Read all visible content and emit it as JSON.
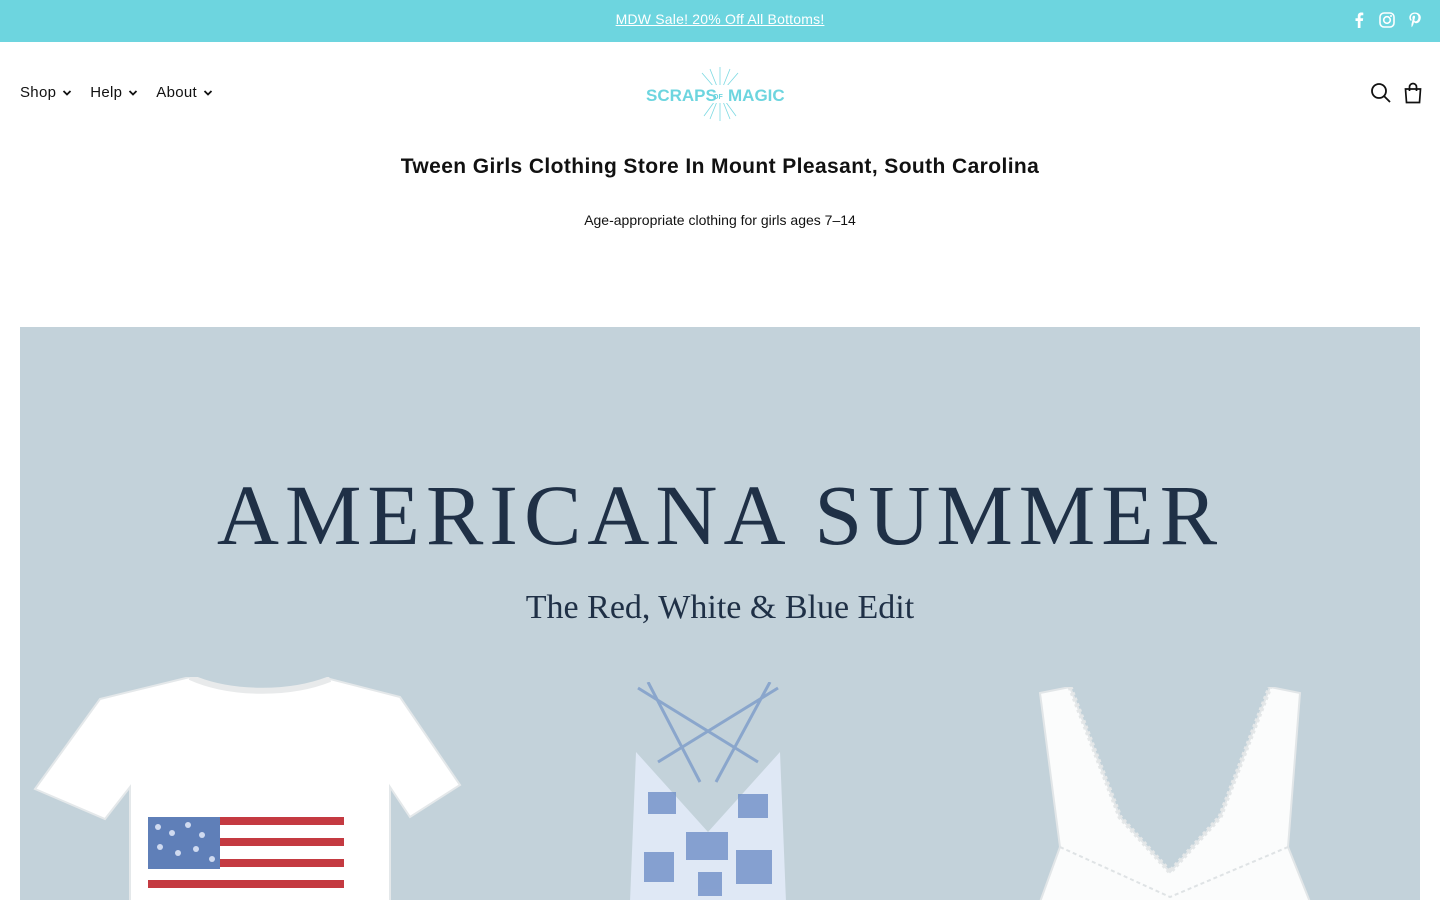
{
  "announcement": {
    "text": "MDW Sale! 20% Off All Bottoms!"
  },
  "social": [
    {
      "icon": "facebook-icon"
    },
    {
      "icon": "instagram-icon"
    },
    {
      "icon": "pinterest-icon"
    }
  ],
  "nav": {
    "items": [
      {
        "label": "Shop"
      },
      {
        "label": "Help"
      },
      {
        "label": "About"
      }
    ]
  },
  "logo": {
    "line1": "SCRAPS",
    "small": "OF",
    "line2": "MAGIC"
  },
  "header_actions": [
    {
      "icon": "search-icon"
    },
    {
      "icon": "cart-icon"
    }
  ],
  "page": {
    "title": "Tween Girls Clothing Store In Mount Pleasant, South Carolina",
    "subtitle": "Age-appropriate clothing for girls ages 7–14"
  },
  "hero": {
    "title": "AMERICANA SUMMER",
    "subtitle": "The Red, White & Blue Edit"
  },
  "colors": {
    "announcement_bg": "#6dd5df",
    "logo": "#6dd5df",
    "hero_bg": "#c3d2da",
    "hero_text": "#1f3046"
  }
}
